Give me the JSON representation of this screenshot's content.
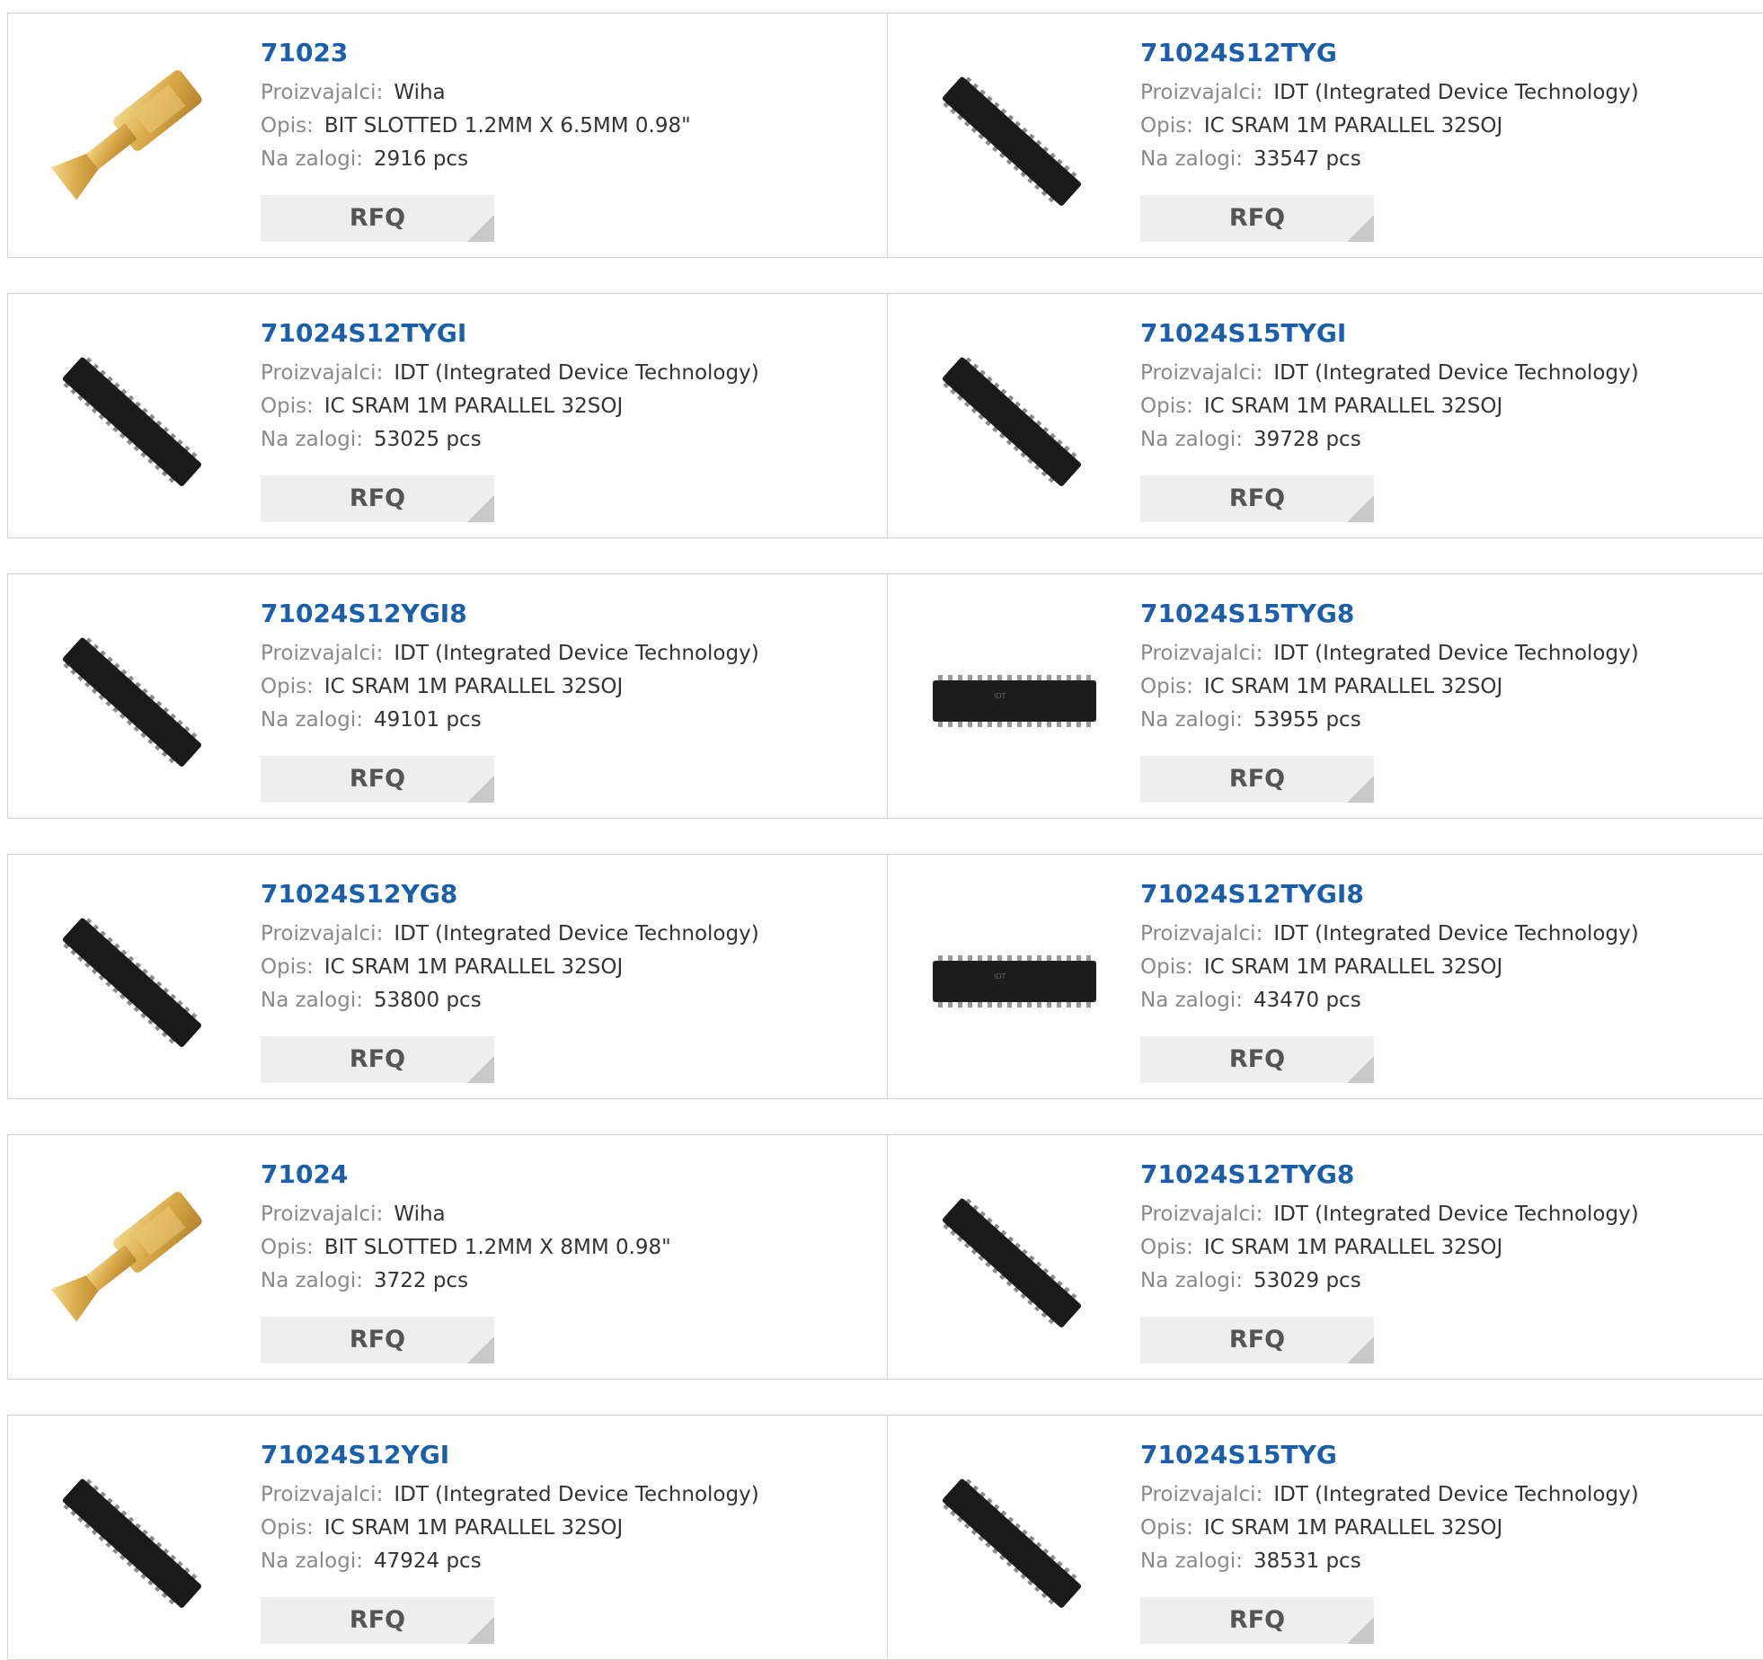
{
  "labels": {
    "manufacturer": "Proizvajalci:",
    "description": "Opis:",
    "stock": "Na zalogi:",
    "rfq": "RFQ"
  },
  "products": [
    {
      "part": "71023",
      "manufacturer": "Wiha",
      "description": "BIT SLOTTED 1.2MM X 6.5MM 0.98\"",
      "stock": "2916 pcs",
      "image": "screwdriver-bit-icon"
    },
    {
      "part": "71024S12TYG",
      "manufacturer": "IDT (Integrated Device Technology)",
      "description": "IC SRAM 1M PARALLEL 32SOJ",
      "stock": "33547 pcs",
      "image": "ic-chip-angled-icon"
    },
    {
      "part": "71024S12TYGI",
      "manufacturer": "IDT (Integrated Device Technology)",
      "description": "IC SRAM 1M PARALLEL 32SOJ",
      "stock": "53025 pcs",
      "image": "ic-chip-angled-icon"
    },
    {
      "part": "71024S15TYGI",
      "manufacturer": "IDT (Integrated Device Technology)",
      "description": "IC SRAM 1M PARALLEL 32SOJ",
      "stock": "39728 pcs",
      "image": "ic-chip-angled-icon"
    },
    {
      "part": "71024S12YGI8",
      "manufacturer": "IDT (Integrated Device Technology)",
      "description": "IC SRAM 1M PARALLEL 32SOJ",
      "stock": "49101 pcs",
      "image": "ic-chip-angled-icon"
    },
    {
      "part": "71024S15TYG8",
      "manufacturer": "IDT (Integrated Device Technology)",
      "description": "IC SRAM 1M PARALLEL 32SOJ",
      "stock": "53955 pcs",
      "image": "ic-chip-flat-icon"
    },
    {
      "part": "71024S12YG8",
      "manufacturer": "IDT (Integrated Device Technology)",
      "description": "IC SRAM 1M PARALLEL 32SOJ",
      "stock": "53800 pcs",
      "image": "ic-chip-angled-icon"
    },
    {
      "part": "71024S12TYGI8",
      "manufacturer": "IDT (Integrated Device Technology)",
      "description": "IC SRAM 1M PARALLEL 32SOJ",
      "stock": "43470 pcs",
      "image": "ic-chip-flat-icon"
    },
    {
      "part": "71024",
      "manufacturer": "Wiha",
      "description": "BIT SLOTTED 1.2MM X 8MM 0.98\"",
      "stock": "3722 pcs",
      "image": "screwdriver-bit-icon"
    },
    {
      "part": "71024S12TYG8",
      "manufacturer": "IDT (Integrated Device Technology)",
      "description": "IC SRAM 1M PARALLEL 32SOJ",
      "stock": "53029 pcs",
      "image": "ic-chip-angled-icon"
    },
    {
      "part": "71024S12YGI",
      "manufacturer": "IDT (Integrated Device Technology)",
      "description": "IC SRAM 1M PARALLEL 32SOJ",
      "stock": "47924 pcs",
      "image": "ic-chip-angled-icon"
    },
    {
      "part": "71024S15TYG",
      "manufacturer": "IDT (Integrated Device Technology)",
      "description": "IC SRAM 1M PARALLEL 32SOJ",
      "stock": "38531 pcs",
      "image": "ic-chip-angled-icon"
    }
  ]
}
